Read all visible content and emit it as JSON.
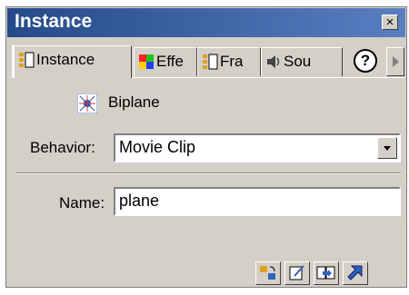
{
  "panel": {
    "title": "Instance",
    "close_glyph": "×"
  },
  "tabs": [
    {
      "label": "Instance",
      "icon": "instance-icon",
      "active": true
    },
    {
      "label": "Effe",
      "icon": "effect-icon",
      "active": false
    },
    {
      "label": "Fra",
      "icon": "frame-icon",
      "active": false
    },
    {
      "label": "Sou",
      "icon": "sound-icon",
      "active": false
    }
  ],
  "help": {
    "label": "?"
  },
  "symbol": {
    "name": "Biplane",
    "icon": "movie-clip-icon"
  },
  "behavior": {
    "label": "Behavior:",
    "value": "Movie Clip"
  },
  "name": {
    "label": "Name:",
    "value": "plane"
  },
  "toolbar": {
    "buttons": [
      "swap-symbol-icon",
      "edit-actions-icon",
      "edit-symbol-icon",
      "launch-icon"
    ]
  },
  "colors": {
    "titlebar": "#2a5298",
    "face": "#d4d0c8"
  }
}
